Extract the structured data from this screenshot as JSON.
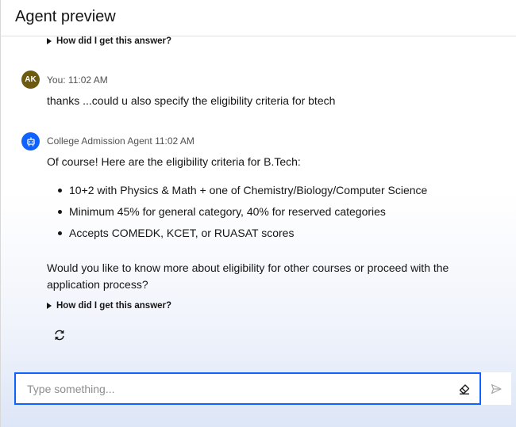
{
  "header": {
    "title": "Agent preview"
  },
  "disclosure_label": "How did I get this answer?",
  "messages": {
    "user": {
      "avatar_initials": "AK",
      "meta": "You: 11:02 AM",
      "text": "thanks ...could u also specify the eligibility criteria for btech"
    },
    "agent": {
      "meta": "College Admission Agent 11:02 AM",
      "intro": "Of course! Here are the eligibility criteria for B.Tech:",
      "bullets": [
        "10+2 with Physics & Math + one of Chemistry/Biology/Computer Science",
        "Minimum 45% for general category, 40% for reserved categories",
        "Accepts COMEDK, KCET, or RUASAT scores"
      ],
      "followup": "Would you like to know more about eligibility for other courses or proceed with the application process?"
    }
  },
  "input": {
    "placeholder": "Type something...",
    "value": ""
  },
  "icons": {
    "disclosure": "triangle-right-icon",
    "agent_avatar": "robot-icon",
    "refresh": "refresh-icon",
    "clear": "eraser-icon",
    "send": "send-icon"
  },
  "colors": {
    "accent": "#0f62fe",
    "user_avatar": "#6b5a10",
    "text": "#161616",
    "muted": "#525252"
  }
}
